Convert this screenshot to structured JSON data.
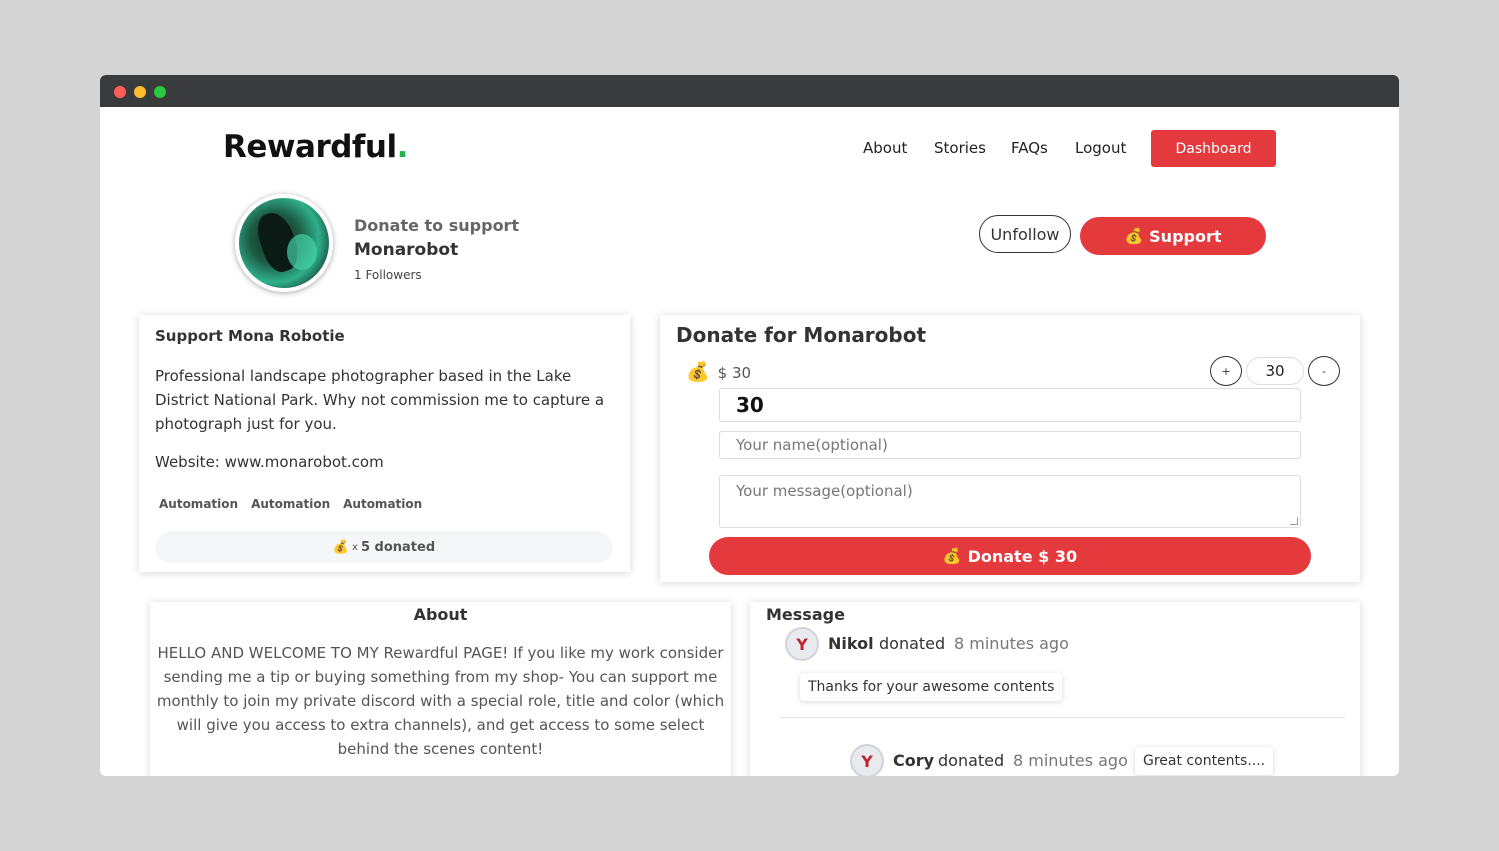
{
  "brand": {
    "name": "Rewardful",
    "dot": "."
  },
  "nav": {
    "about": "About",
    "stories": "Stories",
    "faqs": "FAQs",
    "logout": "Logout",
    "dashboard": "Dashboard"
  },
  "profile": {
    "tagline": "Donate to support",
    "name": "Monarobot",
    "followers": "1 Followers",
    "unfollow": "Unfollow",
    "support": "Support",
    "support_icon": "money-bag-icon"
  },
  "support_card": {
    "title": "Support Mona Robotie",
    "description": "Professional landscape photographer based in the Lake District National Park. Why not commission me to capture a photograph just for you.",
    "website": "Website: www.monarobot.com",
    "tags": [
      "Automation",
      "Automation",
      "Automation"
    ],
    "donated_x": "x",
    "donated_text": "5 donated"
  },
  "donate_card": {
    "title": "Donate for Monarobot",
    "amount_label": "$ 30",
    "stepper_plus": "+",
    "stepper_value": "30",
    "stepper_minus": "-",
    "amount_value": "30",
    "name_placeholder": "Your name(optional)",
    "message_placeholder": "Your message(optional)",
    "donate_button": "Donate $ 30"
  },
  "about_card": {
    "title": "About",
    "body": "HELLO AND WELCOME TO MY Rewardful PAGE! If you like my work consider sending me a tip or buying something from my shop- You can support me monthly to join my private discord with a special role, title and color (which will give you access to extra channels), and get access to some select behind the scenes content!"
  },
  "messages_card": {
    "title": "Message",
    "items": [
      {
        "name": "Nikol",
        "verb": "donated",
        "time": "8 minutes ago",
        "message": "Thanks for your awesome contents"
      },
      {
        "name": "Cory",
        "verb": "donated",
        "time": "8 minutes ago",
        "message": "Great contents...."
      }
    ]
  },
  "colors": {
    "accent": "#e53a3d",
    "brand_dot": "#1fb34d",
    "titlebar": "#3a3b3d"
  }
}
